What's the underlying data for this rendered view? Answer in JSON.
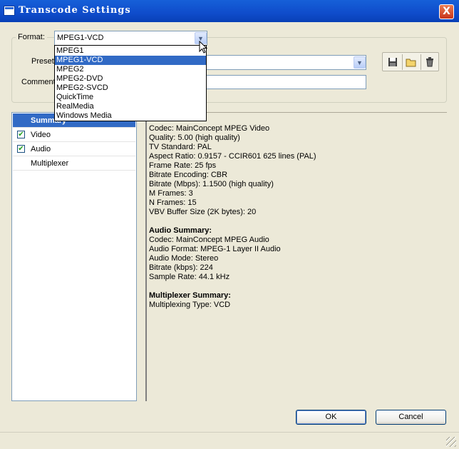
{
  "window": {
    "title": "Transcode Settings",
    "close_label": "X"
  },
  "form": {
    "format_label": "Format:",
    "format_value": "MPEG1-VCD",
    "preset_label": "Preset:",
    "preset_value": "",
    "comment_label": "Comment:",
    "comment_value": ""
  },
  "format_dropdown": {
    "options": [
      "MPEG1",
      "MPEG1-VCD",
      "MPEG2",
      "MPEG2-DVD",
      "MPEG2-SVCD",
      "QuickTime",
      "RealMedia",
      "Windows Media"
    ],
    "selected": "MPEG1-VCD"
  },
  "toolbar": {
    "icons": [
      "save-icon",
      "open-folder-icon",
      "delete-icon"
    ]
  },
  "sections": [
    {
      "label": "Summary",
      "checkbox": false,
      "checked": false,
      "selected": true
    },
    {
      "label": "Video",
      "checkbox": true,
      "checked": true,
      "selected": false
    },
    {
      "label": "Audio",
      "checkbox": true,
      "checked": true,
      "selected": false
    },
    {
      "label": "Multiplexer",
      "checkbox": false,
      "checked": false,
      "selected": false
    }
  ],
  "summary": {
    "video_lines": [
      "Codec: MainConcept MPEG Video",
      "Quality: 5.00 (high quality)",
      "TV Standard: PAL",
      "Aspect Ratio: 0.9157 - CCIR601 625 lines (PAL)",
      "Frame Rate: 25 fps",
      "Bitrate Encoding: CBR",
      "Bitrate (Mbps): 1.1500 (high quality)",
      "M Frames: 3",
      "N Frames: 15",
      "VBV Buffer Size (2K bytes): 20"
    ],
    "audio_heading": "Audio Summary:",
    "audio_lines": [
      "Codec: MainConcept MPEG Audio",
      "Audio Format: MPEG-1 Layer II Audio",
      "Audio Mode: Stereo",
      "Bitrate (kbps): 224",
      "Sample Rate: 44.1 kHz"
    ],
    "mux_heading": "Multiplexer Summary:",
    "mux_lines": [
      "Multiplexing Type: VCD"
    ]
  },
  "buttons": {
    "ok": "OK",
    "cancel": "Cancel"
  }
}
